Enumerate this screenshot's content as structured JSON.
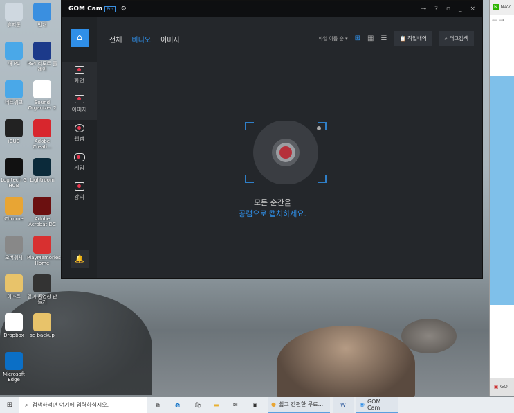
{
  "desktop": {
    "icons": [
      {
        "label": "휴지통",
        "color": "#cfd8e0"
      },
      {
        "label": "번개",
        "color": "#3a8fe0"
      },
      {
        "label": "내 PC",
        "color": "#4aa8e8"
      },
      {
        "label": "PS4 리모트 플레이",
        "color": "#1c3a8a"
      },
      {
        "label": "네트워크",
        "color": "#4aa8e8"
      },
      {
        "label": "Sound Organizer 2",
        "color": "#ffffff"
      },
      {
        "label": "iCUE",
        "color": "#222222"
      },
      {
        "label": "Adobe Creati...",
        "color": "#d8262d"
      },
      {
        "label": "Logitech G HUB",
        "color": "#111111"
      },
      {
        "label": "Lightroom",
        "color": "#0b2a3a"
      },
      {
        "label": "Chrome",
        "color": "#e8a534"
      },
      {
        "label": "Adobe Acrobat DC",
        "color": "#6b1010"
      },
      {
        "label": "오버워치",
        "color": "#888888"
      },
      {
        "label": "PlayMemories Home",
        "color": "#d83030"
      },
      {
        "label": "이마트",
        "color": "#e8c36a"
      },
      {
        "label": "알씨 동영상 만들기",
        "color": "#333333"
      },
      {
        "label": "Dropbox",
        "color": "#ffffff"
      },
      {
        "label": "sd backup",
        "color": "#e8c36a"
      },
      {
        "label": "Microsoft Edge",
        "color": "#0b6fc6"
      }
    ]
  },
  "app": {
    "logo": "GOM Cam",
    "pro": "Pro",
    "gear": "⚙",
    "key": "⊸",
    "help": "?",
    "restore": "▫",
    "minimize": "_",
    "close": "×",
    "sidebar": {
      "home": "⌂",
      "items": [
        {
          "label": "화면"
        },
        {
          "label": "이미지"
        },
        {
          "label": "웹캠"
        },
        {
          "label": "게임"
        },
        {
          "label": "강의"
        }
      ],
      "bell": "🔔"
    },
    "tabs": [
      {
        "label": "전체"
      },
      {
        "label": "비디오",
        "active": true
      },
      {
        "label": "이미지"
      }
    ],
    "sort": "파일 이름 순 ▾",
    "history_button": "작업내역",
    "tag_search_button": "태그검색",
    "message_line1": "모든 순간을",
    "message_line2": "공캠으로 캡처하세요.",
    "accent": "#2f8fe8"
  },
  "taskbar": {
    "search_placeholder": "검색하려면 여기에 입력하십시오.",
    "apps": [
      {
        "label": "쉽고 간편한 무료..."
      },
      {
        "label": "GOM Cam"
      }
    ]
  },
  "browser": {
    "tab": "NAV",
    "bottom": "GO"
  }
}
